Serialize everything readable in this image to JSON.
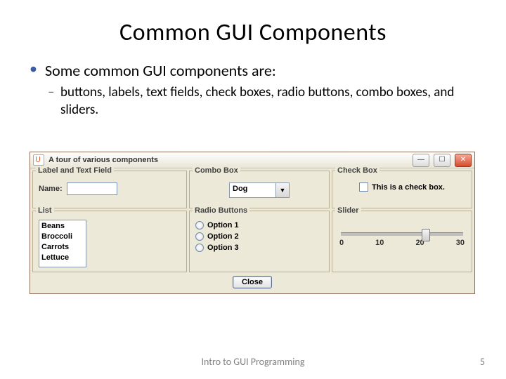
{
  "title": "Common GUI Components",
  "bullet1": "Some common GUI components are:",
  "bullet2": "buttons, labels, text fields, check boxes, radio buttons, combo boxes, and sliders.",
  "window": {
    "title": "A tour of various components",
    "panels": {
      "labeltf": {
        "title": "Label and Text Field",
        "label": "Name:"
      },
      "combo": {
        "title": "Combo Box",
        "value": "Dog"
      },
      "check": {
        "title": "Check Box",
        "label": "This is a check box."
      },
      "list": {
        "title": "List",
        "items": [
          "Beans",
          "Broccoli",
          "Carrots",
          "Lettuce"
        ]
      },
      "radio": {
        "title": "Radio Buttons",
        "options": [
          "Option 1",
          "Option 2",
          "Option 3"
        ]
      },
      "slider": {
        "title": "Slider",
        "ticks": [
          "0",
          "10",
          "20",
          "30"
        ],
        "value_pct": 66
      }
    },
    "close": "Close"
  },
  "footer": "Intro to GUI Programming",
  "page": "5"
}
